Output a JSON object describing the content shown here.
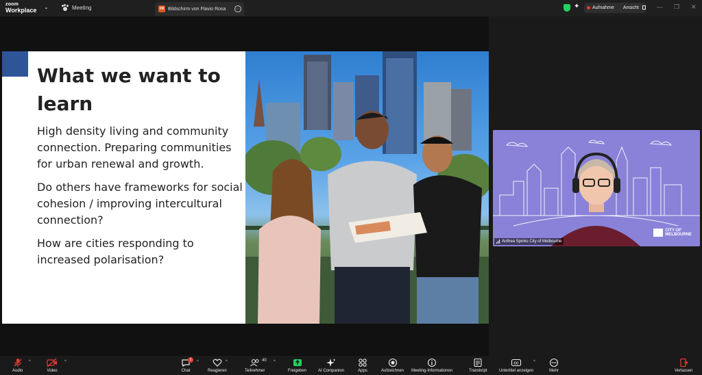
{
  "app": {
    "logo_line1": "zoom",
    "logo_line2": "Workplace"
  },
  "topbar": {
    "meeting_label": "Meeting",
    "share_tab_badge": "FR",
    "share_tab_label": "Bildschirm von Flavio Rosa",
    "recording_label": "Aufnahme",
    "view_label": "Ansicht"
  },
  "slide": {
    "title": "What we want to learn",
    "paragraphs": [
      "High density living and community connection. Preparing communities for urban renewal and growth.",
      "Do others have frameworks for social cohesion / improving intercultural connection?",
      "How are cities responding to increased polarisation?"
    ]
  },
  "video": {
    "participant_name": "Anthea Spinks City of Melbourne",
    "logo_line1": "CITY OF",
    "logo_line2": "MELBOURNE"
  },
  "toolbar": {
    "audio": "Audio",
    "video": "Video",
    "chat": "Chat",
    "chat_badge": "2",
    "react": "Reagieren",
    "participants": "Teilnehmer",
    "participants_count": "40",
    "share": "Freigeben",
    "ai": "AI Companion",
    "apps": "Apps",
    "record": "Aufzeichnen",
    "info": "Meeting-Informationen",
    "transcript": "Transkript",
    "captions": "Untertitel anzeigen",
    "more": "Mehr",
    "leave": "Verlassen"
  },
  "colors": {
    "accent_blue": "#2d5597",
    "record_red": "#e53935",
    "share_green": "#23d160",
    "video_bg": "#8a82d8"
  }
}
